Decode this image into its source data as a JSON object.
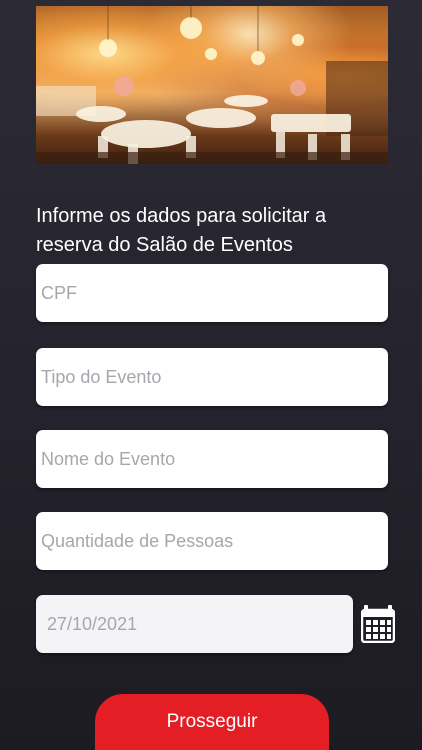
{
  "hero": {
    "image_description": "event hall photo"
  },
  "intro": {
    "text": "Informe os dados para solicitar a reserva do Salão de Eventos"
  },
  "form": {
    "cpf_placeholder": "CPF",
    "cpf_value": "",
    "event_type_placeholder": "Tipo do Evento",
    "event_type_value": "",
    "event_name_placeholder": "Nome do Evento",
    "event_name_value": "",
    "people_count_placeholder": "Quantidade de Pessoas",
    "people_count_value": "",
    "date_value": "27/10/2021",
    "calendar_icon": "calendar-icon"
  },
  "actions": {
    "submit_label": "Prosseguir",
    "submit_color": "#e31e24"
  }
}
